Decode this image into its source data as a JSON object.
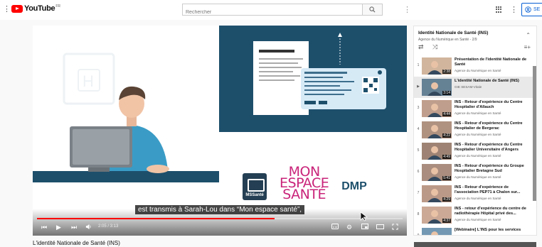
{
  "header": {
    "logo_text": "YouTube",
    "logo_sup": "FR",
    "search_placeholder": "Rechercher",
    "signin_label": "SE"
  },
  "player": {
    "subtitle": "est transmis à Sarah-Lou dans “Mon espace santé”,",
    "time": "2:05 / 3:13",
    "progress": 0.65,
    "logos": {
      "mssante": "MSSanté",
      "mes_line1": "MON",
      "mes_line2": "ESPACE",
      "mes_line3": "SANTÉ",
      "dmp": "DMP"
    }
  },
  "below_player": {
    "title": "L'identité Nationale de Santé (INS)"
  },
  "playlist": {
    "title": "Identité Nationale de Santé (INS)",
    "subtitle": "Agence du Numérique en Santé - 2/9",
    "items": [
      {
        "index": "1",
        "title": "Présentation de l'identité Nationale de Santé",
        "channel": "Agence du Numérique en Santé",
        "duration": "2:38",
        "active": false
      },
      {
        "index": "▶",
        "title": "L'identité Nationale de Santé (INS)",
        "channel": "GIE SESAM-Vitale",
        "duration": "3:14",
        "active": true
      },
      {
        "index": "3",
        "title": "INS - Retour d'expérience du Centre Hospitalier d'Allauch",
        "channel": "Agence du Numérique en Santé",
        "duration": "4:44",
        "active": false
      },
      {
        "index": "4",
        "title": "INS - Retour d'expérience du Centre Hospitalier de Bergerac",
        "channel": "Agence du Numérique en Santé",
        "duration": "4:22",
        "active": false
      },
      {
        "index": "5",
        "title": "INS - Retour d'expérience du Centre Hospitalier Universitaire d'Angers",
        "channel": "Agence du Numérique en Santé",
        "duration": "4:49",
        "active": false
      },
      {
        "index": "6",
        "title": "INS - Retour d'expérience du Groupe Hospitalier Bretagne Sud",
        "channel": "Agence du Numérique en Santé",
        "duration": "5:41",
        "active": false
      },
      {
        "index": "7",
        "title": "INS - Retour d'expérience de l'association PEP71 à Chalon sur...",
        "channel": "Agence du Numérique en Santé",
        "duration": "4:29",
        "active": false
      },
      {
        "index": "8",
        "title": "INS - retour d'expérience du centre de radiothérapie Hôpital privé des...",
        "channel": "Agence du Numérique en Santé",
        "duration": "4:37",
        "active": false
      },
      {
        "index": "9",
        "title": "[Webinaire] L'INS pour les services",
        "channel": "",
        "duration": "",
        "active": false
      }
    ]
  }
}
